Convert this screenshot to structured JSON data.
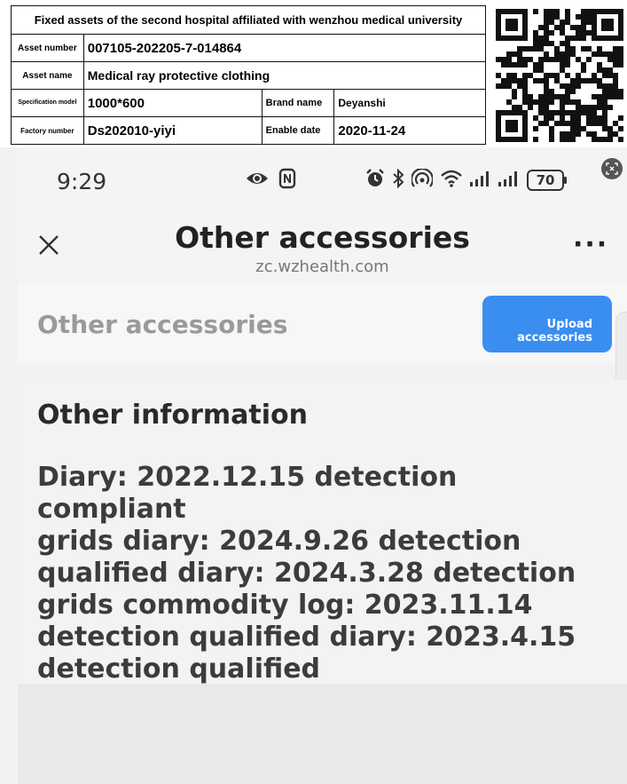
{
  "label": {
    "title": "Fixed assets of the second hospital affiliated with wenzhou medical university",
    "asset_number_label": "Asset number",
    "asset_number": "007105-202205-7-014864",
    "asset_name_label": "Asset name",
    "asset_name": "Medical ray protective clothing",
    "spec_label": "Specification model",
    "spec": "1000*600",
    "brand_label": "Brand name",
    "brand": "Deyanshi",
    "factory_label": "Factory number",
    "factory": "Ds202010-yiyi",
    "enable_label": "Enable date",
    "enable_date": "2020-11-24"
  },
  "status_bar": {
    "time": "9:29",
    "battery": "70",
    "icons": [
      "eye-icon",
      "nfc-icon",
      "alarm-icon",
      "bluetooth-icon",
      "hotspot-icon",
      "wifi-icon",
      "signal-icon",
      "signal-icon"
    ]
  },
  "nav": {
    "title": "Other accessories",
    "url": "zc.wzhealth.com",
    "more": "···"
  },
  "accessories": {
    "title": "Other accessories",
    "upload_label_1": "Upload",
    "upload_label_2": "accessories"
  },
  "info": {
    "title": "Other information",
    "lines": [
      "Diary: 2022.12.15 detection compliant",
      "grids diary: 2024.9.26 detection",
      "qualified diary: 2024.3.28 detection",
      "grids commodity log: 2023.11.14",
      "detection qualified diary: 2023.4.15",
      "detection qualified"
    ]
  },
  "colors": {
    "accent": "#3a8ef0",
    "muted_text": "#9a9a9a",
    "body_text": "#3c3c3c"
  }
}
